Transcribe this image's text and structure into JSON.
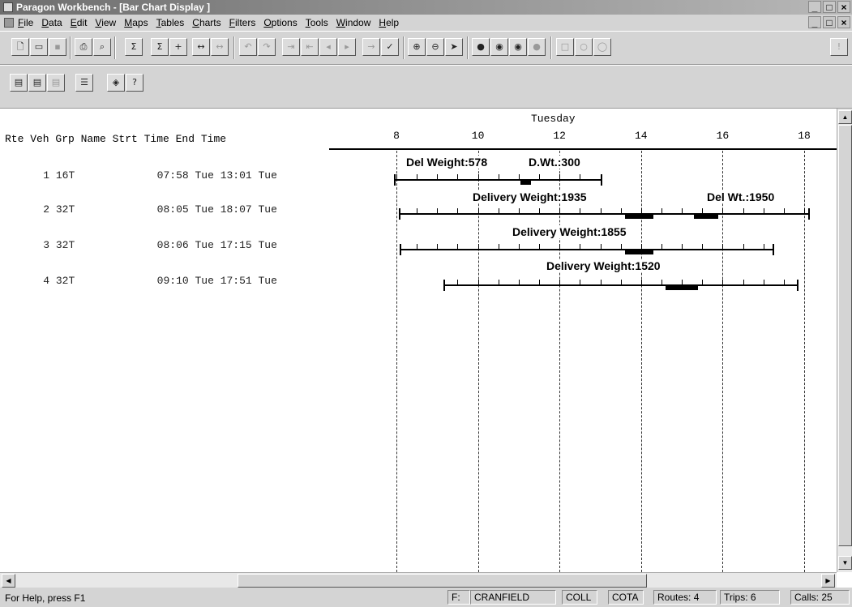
{
  "window": {
    "title": "Paragon Workbench - [Bar Chart Display ]",
    "minimize": "_",
    "maximize": "□",
    "close": "×"
  },
  "menu": [
    "File",
    "Data",
    "Edit",
    "View",
    "Maps",
    "Tables",
    "Charts",
    "Filters",
    "Options",
    "Tools",
    "Window",
    "Help"
  ],
  "toolbar_icons": [
    "new-file",
    "open-folder",
    "save",
    "print",
    "print-preview",
    "edit-route",
    "edit-vehicle",
    "add",
    "move-left-right",
    "move-disabled",
    "undo",
    "redo",
    "split",
    "join",
    "arrow-left",
    "arrow-right",
    "insert",
    "check",
    "zoom-in",
    "zoom-out",
    "pointer",
    "map-pin-1",
    "map-pin-2",
    "map-pin-3",
    "map-pin-4",
    "select-rect",
    "select-ellipse",
    "select-circle",
    "extra"
  ],
  "table": {
    "header": "Rte Veh Grp Name Strt Time End Time",
    "day_label": "Tuesday",
    "rows": [
      {
        "rte": "1",
        "veh": "16T",
        "start": "07:58 Tue",
        "end": "13:01 Tue"
      },
      {
        "rte": "2",
        "veh": "32T",
        "start": "08:05 Tue",
        "end": "18:07 Tue"
      },
      {
        "rte": "3",
        "veh": "32T",
        "start": "08:06 Tue",
        "end": "17:15 Tue"
      },
      {
        "rte": "4",
        "veh": "32T",
        "start": "09:10 Tue",
        "end": "17:51 Tue"
      }
    ]
  },
  "chart_data": {
    "type": "bar",
    "xlabel": "Tuesday",
    "ticks": [
      8,
      10,
      12,
      14,
      16,
      18
    ],
    "xlim": [
      8,
      18
    ],
    "routes": [
      {
        "route": 1,
        "start": 7.97,
        "end": 13.02,
        "deliveries": [
          {
            "label": "Del Weight:578",
            "at": 11.1
          },
          {
            "label": "D.Wt.:300",
            "at": 11.1
          }
        ]
      },
      {
        "route": 2,
        "start": 8.08,
        "end": 18.12,
        "deliveries": [
          {
            "label": "Delivery Weight:1935",
            "at": 14.0
          },
          {
            "label": "Del Wt.:1950",
            "at": 15.5
          }
        ]
      },
      {
        "route": 3,
        "start": 8.1,
        "end": 17.25,
        "deliveries": [
          {
            "label": "Delivery Weight:1855",
            "at": 14.0
          }
        ]
      },
      {
        "route": 4,
        "start": 9.17,
        "end": 17.85,
        "deliveries": [
          {
            "label": "Delivery Weight:1520",
            "at": 15.0
          }
        ]
      }
    ]
  },
  "status": {
    "help": "For Help, press F1",
    "f": "F:",
    "depot": "CRANFIELD",
    "coll": "COLL",
    "cota": "COTA",
    "routes": "Routes:  4",
    "trips": "Trips:   6",
    "calls": "Calls:  25"
  }
}
